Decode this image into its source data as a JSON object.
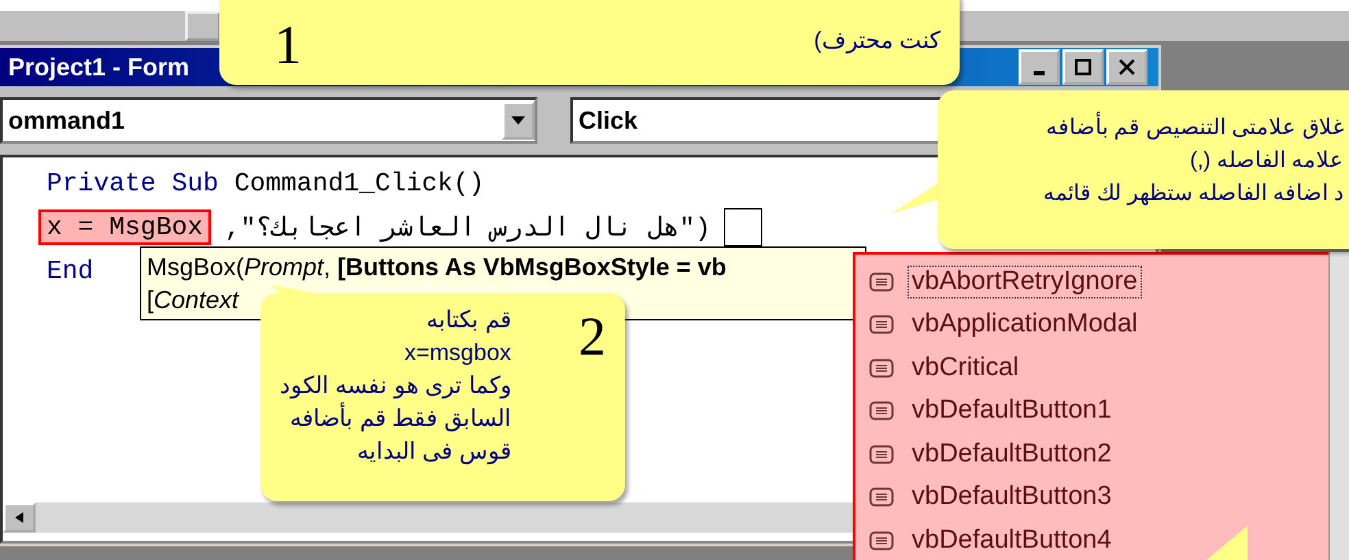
{
  "callouts": [
    {
      "lines": [
        "كنت محترف)"
      ],
      "number": "1"
    },
    {
      "lines": [
        "قم بكتابه",
        "x=msgbox",
        "وكما ترى هو نفسه الكود",
        "السابق فقط قم بأضافه",
        "قوس فى البدايه"
      ],
      "number": "2"
    },
    {
      "lines": [
        "غلاق علامتى التنصيص قم بأضافه",
        "علامه الفاصله (,)",
        "د اضافه الفاصله ستظهر لك قائمه"
      ]
    }
  ],
  "window": {
    "title": "Project1 - Form"
  },
  "object_combo": {
    "value": "ommand1"
  },
  "procedure_combo": {
    "value": "Click"
  },
  "code": [
    {
      "keyword": "Private Sub",
      "text": "Command1_Click()"
    },
    {
      "highlight": "x = MsgBox",
      "argument": "(\"هل نال الدرس العاشر اعجابك؟\","
    },
    {
      "keyword": "End"
    }
  ],
  "tooltip": {
    "lines": [
      "MsgBox(*Prompt*, **[Buttons As VbMsgBoxStyle = vb**",
      "[*Context*"
    ]
  },
  "completion_list": [
    {
      "label": "vbAbortRetryIgnore",
      "selected": true
    },
    {
      "label": "vbApplicationModal",
      "selected": false
    },
    {
      "label": "vbCritical",
      "selected": false
    },
    {
      "label": "vbDefaultButton1",
      "selected": false
    },
    {
      "label": "vbDefaultButton2",
      "selected": false
    },
    {
      "label": "vbDefaultButton3",
      "selected": false
    },
    {
      "label": "vbDefaultButton4",
      "selected": false
    }
  ]
}
